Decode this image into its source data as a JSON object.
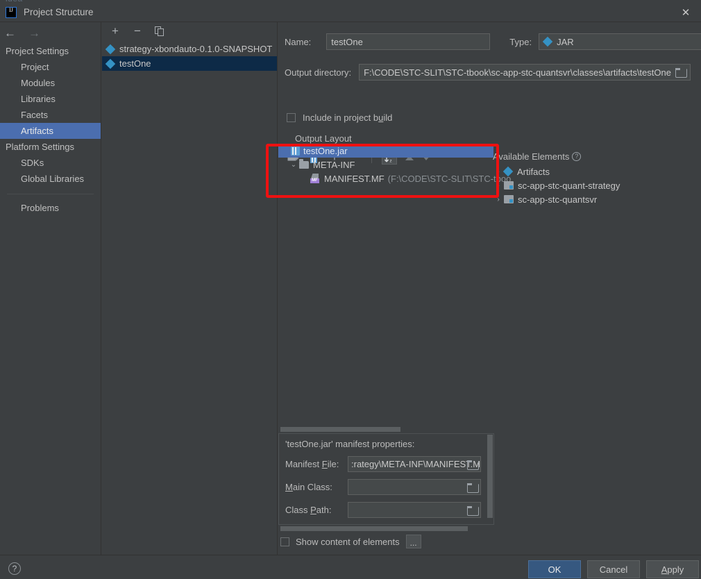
{
  "window": {
    "title": "Project Structure",
    "app_icon": "intellij-idea-icon",
    "close_label": "✕",
    "background": "#3c3f41",
    "accent": "#4b6eaf",
    "selection_blue": "#0d2a47",
    "annotation_color": "#ee1111"
  },
  "sidebar": {
    "back_arrow": "←",
    "forward_arrow": "→",
    "groups": [
      {
        "title": "Project Settings",
        "items": [
          {
            "label": "Project",
            "selected": false
          },
          {
            "label": "Modules",
            "selected": false
          },
          {
            "label": "Libraries",
            "selected": false
          },
          {
            "label": "Facets",
            "selected": false
          },
          {
            "label": "Artifacts",
            "selected": true
          }
        ]
      },
      {
        "title": "Platform Settings",
        "items": [
          {
            "label": "SDKs",
            "selected": false
          },
          {
            "label": "Global Libraries",
            "selected": false
          }
        ]
      }
    ],
    "problems_label": "Problems"
  },
  "artifacts_panel": {
    "toolbar": {
      "add_label": "+",
      "remove_label": "−",
      "copy_label": "copy-icon"
    },
    "items": [
      {
        "label": "strategy-xbondauto-0.1.0-SNAPSHOT",
        "selected": false
      },
      {
        "label": "testOne",
        "selected": true
      }
    ]
  },
  "editor": {
    "name_label": "Name:",
    "name_value": "testOne",
    "type_label": "Type:",
    "type_value": "JAR",
    "output_dir_label": "Output directory:",
    "output_dir_value": "F:\\CODE\\STC-SLIT\\STC-tbook\\sc-app-stc-quantsvr\\classes\\artifacts\\testOne",
    "include_in_build_label": "Include in project build",
    "include_in_build_checked": false,
    "output_layout_label": "Output Layout",
    "layout_toolbar": {
      "add_dir_label": "add-directory-icon",
      "add_archive_label": "add-archive-icon",
      "add_label": "+",
      "remove_label": "−",
      "sort_label": "sort-az-icon",
      "move_up_label": "move-up-icon",
      "move_down_label": "move-down-icon"
    },
    "tree": [
      {
        "indent": 0,
        "twisty": "",
        "icon": "jar-icon",
        "label": "testOne.jar",
        "detail": "",
        "selected": true
      },
      {
        "indent": 1,
        "twisty": "⌄",
        "icon": "folder-icon",
        "label": "META-INF",
        "detail": "",
        "selected": false
      },
      {
        "indent": 2,
        "twisty": "",
        "icon": "manifest-icon",
        "label": "MANIFEST.MF",
        "detail": "(F:\\CODE\\STC-SLIT\\STC-tboo",
        "selected": false
      }
    ],
    "available_elements_label": "Available Elements",
    "available_help_label": "?",
    "available": [
      {
        "twisty": "›",
        "icon": "artifacts-diamond-icon",
        "label": "Artifacts"
      },
      {
        "twisty": "›",
        "icon": "module-icon",
        "label": "sc-app-stc-quant-strategy"
      },
      {
        "twisty": "›",
        "icon": "module-icon",
        "label": "sc-app-stc-quantsvr"
      }
    ]
  },
  "manifest": {
    "title": "'testOne.jar' manifest properties:",
    "rows": [
      {
        "label": "Manifest File:",
        "value": ":rategy\\META-INF\\MANIFEST.MF"
      },
      {
        "label": "Main Class:",
        "value": ""
      },
      {
        "label": "Class Path:",
        "value": ""
      }
    ],
    "show_content_label": "Show content of elements",
    "show_content_checked": false,
    "more_button_label": "..."
  },
  "footer": {
    "help_label": "?",
    "ok_label": "OK",
    "cancel_label": "Cancel",
    "apply_label": "Apply"
  }
}
